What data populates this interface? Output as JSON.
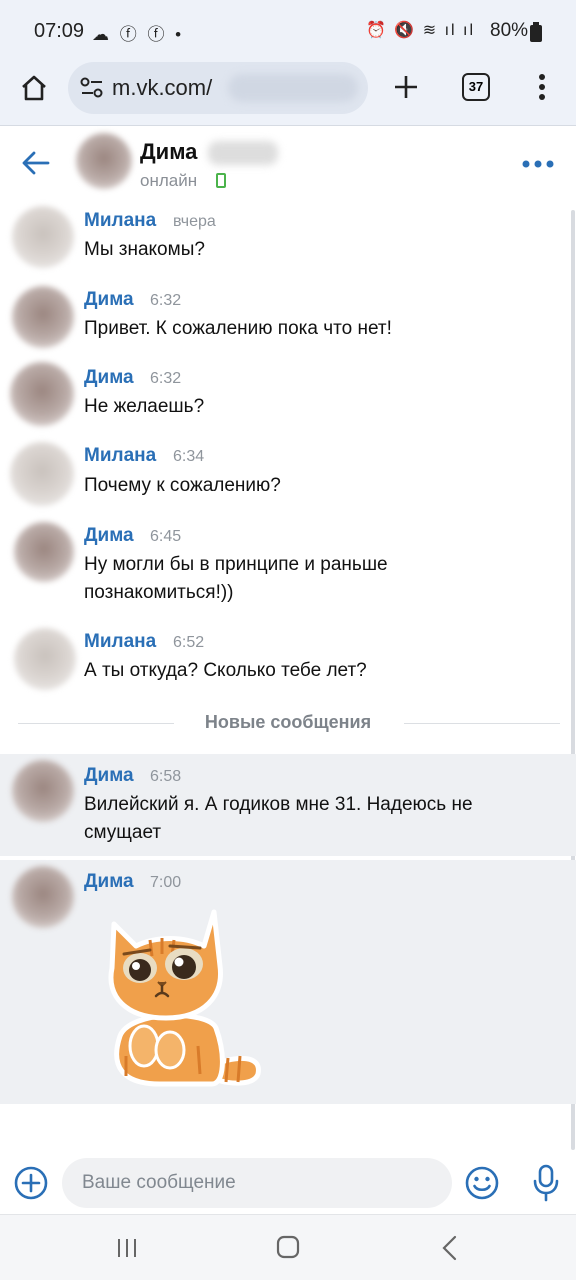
{
  "status_bar": {
    "time": "07:09",
    "battery": "80%"
  },
  "browser": {
    "url": "m.vk.com/",
    "tab_count": "37"
  },
  "chat_header": {
    "name": "Дима",
    "status": "онлайн"
  },
  "messages": [
    {
      "author": "Милана",
      "time": "вчера",
      "text": "Мы знакомы?"
    },
    {
      "author": "Дима",
      "time": "6:32",
      "text": "Привет. К сожалению пока что нет!"
    },
    {
      "author": "Дима",
      "time": "6:32",
      "text": "Не желаешь?"
    },
    {
      "author": "Милана",
      "time": "6:34",
      "text": "Почему к сожалению?"
    },
    {
      "author": "Дима",
      "time": "6:45",
      "text": "Ну могли бы в принципе и раньше познакомиться!))"
    },
    {
      "author": "Милана",
      "time": "6:52",
      "text": "А ты откуда? Сколько тебе лет?"
    },
    {
      "author": "Дима",
      "time": "6:58",
      "text": "Вилейский я. А годиков мне 31. Надеюсь не смущает"
    },
    {
      "author": "Дима",
      "time": "7:00",
      "text": ""
    }
  ],
  "new_messages_divider": "Новые сообщения",
  "input": {
    "placeholder": "Ваше сообщение"
  },
  "colors": {
    "accent": "#2a6fb6",
    "online": "#4bb34b",
    "highlight_bg": "#eef0f3"
  },
  "icons": {
    "back": "arrow-left",
    "more": "three-dots",
    "add": "plus-circle",
    "emoji": "smiley",
    "mic": "microphone",
    "sticker": "crying-orange-cat"
  }
}
